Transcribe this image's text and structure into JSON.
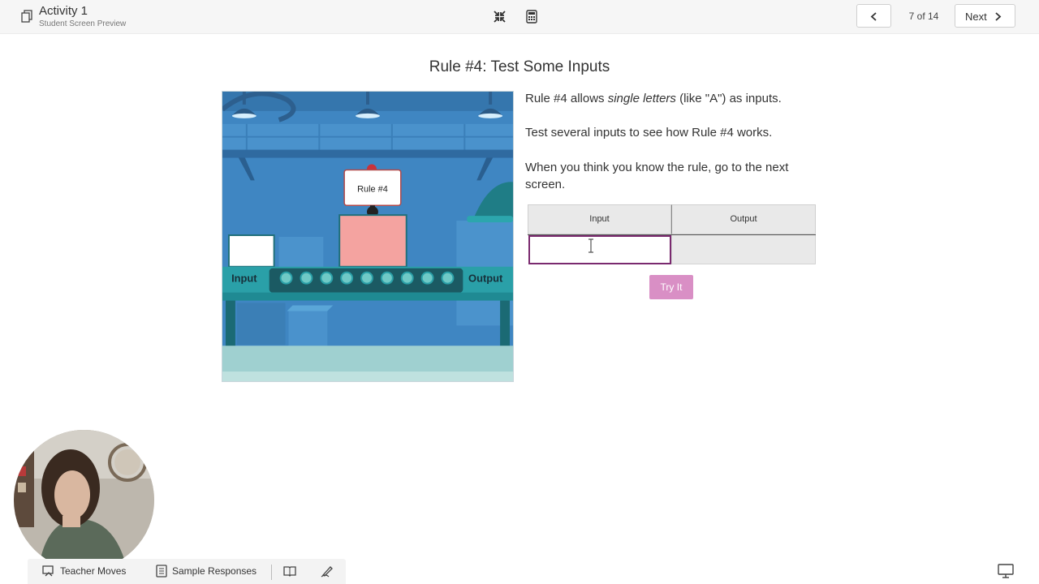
{
  "topbar": {
    "activity_title": "Activity 1",
    "activity_subtitle": "Student Screen Preview",
    "page_counter": "7 of 14",
    "next_label": "Next"
  },
  "screen": {
    "title": "Rule #4: Test Some Inputs",
    "machine": {
      "rule_label": "Rule #4",
      "input_label": "Input",
      "output_label": "Output"
    },
    "instructions": {
      "p1_before": "Rule #4 allows ",
      "p1_emph": "single letters",
      "p1_after": " (like \"A\") as inputs.",
      "p2": "Test several inputs to see how Rule #4 works.",
      "p3": "When you think you know the rule, go to the next screen."
    },
    "table": {
      "headers": [
        "Input",
        "Output"
      ],
      "input_value": "",
      "output_value": ""
    },
    "try_button": "Try It"
  },
  "bottombar": {
    "teacher_moves": "Teacher Moves",
    "sample_responses": "Sample Responses"
  },
  "icons": [
    "copy-icon",
    "compress-icon",
    "calculator-icon",
    "chevron-left-icon",
    "chevron-right-icon",
    "teacher-moves-icon",
    "sample-responses-icon",
    "book-icon",
    "pen-icon",
    "present-icon"
  ],
  "colors": {
    "accent_purple": "#7a2a6f",
    "try_button": "#d98fc5",
    "machine_sky": "#3f86c2"
  }
}
